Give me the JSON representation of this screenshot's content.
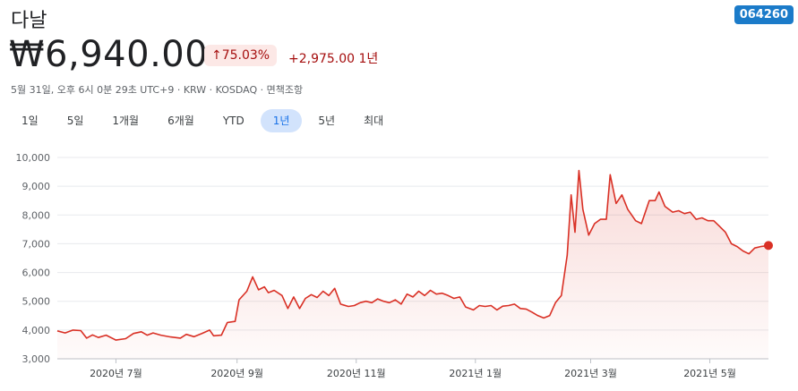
{
  "header": {
    "company_name": "다날",
    "ticker_code": "064260",
    "price": "₩6,940.00",
    "change_percent_icon": "arrow-up-icon",
    "change_percent": "↑75.03%",
    "change_absolute": "+2,975.00 1년",
    "meta_line": "5월 31일, 오후 6시 0분 29초 UTC+9 · KRW · KOSDAQ · 면책조항"
  },
  "colors": {
    "line": "#d93025",
    "fill": "#fce8e6",
    "ticker_bg": "#1b7bc9",
    "active_tab": "#d2e3fc"
  },
  "tabs": [
    {
      "label": "1일",
      "active": false
    },
    {
      "label": "5일",
      "active": false
    },
    {
      "label": "1개월",
      "active": false
    },
    {
      "label": "6개월",
      "active": false
    },
    {
      "label": "YTD",
      "active": false
    },
    {
      "label": "1년",
      "active": true
    },
    {
      "label": "5년",
      "active": false
    },
    {
      "label": "최대",
      "active": false
    }
  ],
  "chart_data": {
    "type": "area",
    "title": "",
    "xlabel": "",
    "ylabel": "",
    "ylim": [
      3000,
      10000
    ],
    "y_ticks": [
      "3,000",
      "4,000",
      "5,000",
      "6,000",
      "7,000",
      "8,000",
      "9,000",
      "10,000"
    ],
    "y_tick_values": [
      3000,
      4000,
      5000,
      6000,
      7000,
      8000,
      9000,
      10000
    ],
    "x_ticks": [
      "2020년 7월",
      "2020년 9월",
      "2020년 11월",
      "2021년 1월",
      "2021년 3월",
      "2021년 5월"
    ],
    "x_tick_dates": [
      "2020-07-01",
      "2020-09-01",
      "2020-11-01",
      "2021-01-01",
      "2021-03-01",
      "2021-05-01"
    ],
    "x_range": [
      "2020-06-01",
      "2021-05-31"
    ],
    "grid": true,
    "series": [
      {
        "values": [
          [
            "2020-06-01",
            3970
          ],
          [
            "2020-06-05",
            3900
          ],
          [
            "2020-06-09",
            4000
          ],
          [
            "2020-06-13",
            3980
          ],
          [
            "2020-06-16",
            3720
          ],
          [
            "2020-06-19",
            3830
          ],
          [
            "2020-06-22",
            3740
          ],
          [
            "2020-06-26",
            3820
          ],
          [
            "2020-07-01",
            3650
          ],
          [
            "2020-07-06",
            3700
          ],
          [
            "2020-07-10",
            3880
          ],
          [
            "2020-07-14",
            3940
          ],
          [
            "2020-07-17",
            3820
          ],
          [
            "2020-07-20",
            3900
          ],
          [
            "2020-07-24",
            3820
          ],
          [
            "2020-07-29",
            3760
          ],
          [
            "2020-08-03",
            3720
          ],
          [
            "2020-08-06",
            3850
          ],
          [
            "2020-08-10",
            3770
          ],
          [
            "2020-08-14",
            3880
          ],
          [
            "2020-08-18",
            4000
          ],
          [
            "2020-08-20",
            3800
          ],
          [
            "2020-08-24",
            3820
          ],
          [
            "2020-08-27",
            4260
          ],
          [
            "2020-08-31",
            4300
          ],
          [
            "2020-09-02",
            5050
          ],
          [
            "2020-09-06",
            5350
          ],
          [
            "2020-09-09",
            5850
          ],
          [
            "2020-09-12",
            5400
          ],
          [
            "2020-09-15",
            5500
          ],
          [
            "2020-09-17",
            5300
          ],
          [
            "2020-09-20",
            5380
          ],
          [
            "2020-09-24",
            5200
          ],
          [
            "2020-09-27",
            4750
          ],
          [
            "2020-09-30",
            5150
          ],
          [
            "2020-10-03",
            4750
          ],
          [
            "2020-10-06",
            5100
          ],
          [
            "2020-10-09",
            5230
          ],
          [
            "2020-10-12",
            5130
          ],
          [
            "2020-10-15",
            5350
          ],
          [
            "2020-10-18",
            5200
          ],
          [
            "2020-10-21",
            5450
          ],
          [
            "2020-10-24",
            4900
          ],
          [
            "2020-10-28",
            4820
          ],
          [
            "2020-10-31",
            4850
          ],
          [
            "2020-11-03",
            4950
          ],
          [
            "2020-11-06",
            5000
          ],
          [
            "2020-11-09",
            4950
          ],
          [
            "2020-11-12",
            5080
          ],
          [
            "2020-11-15",
            5000
          ],
          [
            "2020-11-18",
            4950
          ],
          [
            "2020-11-21",
            5050
          ],
          [
            "2020-11-24",
            4900
          ],
          [
            "2020-11-27",
            5250
          ],
          [
            "2020-11-30",
            5150
          ],
          [
            "2020-12-03",
            5350
          ],
          [
            "2020-12-06",
            5200
          ],
          [
            "2020-12-09",
            5380
          ],
          [
            "2020-12-12",
            5250
          ],
          [
            "2020-12-15",
            5280
          ],
          [
            "2020-12-18",
            5200
          ],
          [
            "2020-12-21",
            5100
          ],
          [
            "2020-12-24",
            5150
          ],
          [
            "2020-12-27",
            4800
          ],
          [
            "2020-12-31",
            4700
          ],
          [
            "2021-01-03",
            4850
          ],
          [
            "2021-01-06",
            4820
          ],
          [
            "2021-01-09",
            4850
          ],
          [
            "2021-01-12",
            4700
          ],
          [
            "2021-01-15",
            4830
          ],
          [
            "2021-01-18",
            4850
          ],
          [
            "2021-01-21",
            4900
          ],
          [
            "2021-01-24",
            4750
          ],
          [
            "2021-01-27",
            4730
          ],
          [
            "2021-01-30",
            4620
          ],
          [
            "2021-02-02",
            4500
          ],
          [
            "2021-02-05",
            4420
          ],
          [
            "2021-02-08",
            4500
          ],
          [
            "2021-02-11",
            4950
          ],
          [
            "2021-02-14",
            5200
          ],
          [
            "2021-02-17",
            6600
          ],
          [
            "2021-02-19",
            8700
          ],
          [
            "2021-02-21",
            7400
          ],
          [
            "2021-02-23",
            9550
          ],
          [
            "2021-02-25",
            8200
          ],
          [
            "2021-02-28",
            7300
          ],
          [
            "2021-03-03",
            7700
          ],
          [
            "2021-03-06",
            7850
          ],
          [
            "2021-03-09",
            7850
          ],
          [
            "2021-03-11",
            9400
          ],
          [
            "2021-03-14",
            8400
          ],
          [
            "2021-03-17",
            8700
          ],
          [
            "2021-03-20",
            8200
          ],
          [
            "2021-03-24",
            7800
          ],
          [
            "2021-03-27",
            7700
          ],
          [
            "2021-03-31",
            8500
          ],
          [
            "2021-04-03",
            8500
          ],
          [
            "2021-04-05",
            8800
          ],
          [
            "2021-04-08",
            8300
          ],
          [
            "2021-04-12",
            8100
          ],
          [
            "2021-04-15",
            8150
          ],
          [
            "2021-04-18",
            8050
          ],
          [
            "2021-04-21",
            8100
          ],
          [
            "2021-04-24",
            7850
          ],
          [
            "2021-04-27",
            7900
          ],
          [
            "2021-04-30",
            7800
          ],
          [
            "2021-05-03",
            7800
          ],
          [
            "2021-05-06",
            7600
          ],
          [
            "2021-05-09",
            7400
          ],
          [
            "2021-05-12",
            7000
          ],
          [
            "2021-05-15",
            6900
          ],
          [
            "2021-05-18",
            6750
          ],
          [
            "2021-05-21",
            6650
          ],
          [
            "2021-05-24",
            6850
          ],
          [
            "2021-05-27",
            6900
          ],
          [
            "2021-05-31",
            6940
          ]
        ]
      }
    ]
  }
}
